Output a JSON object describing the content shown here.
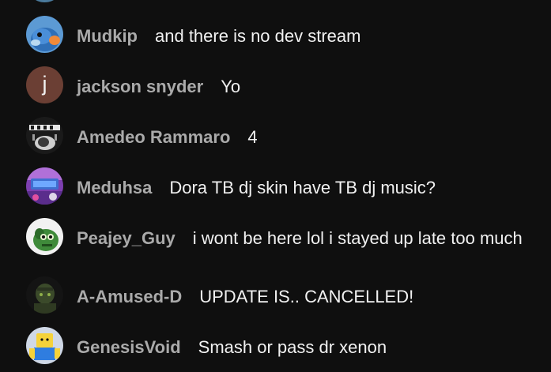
{
  "messages": [
    {
      "author": "Mudkip",
      "text": "and there is no dev stream",
      "avatar": "mudkip-avatar",
      "avatar_letter": ""
    },
    {
      "author": "jackson snyder",
      "text": "Yo",
      "avatar": "letter-avatar",
      "avatar_letter": "j"
    },
    {
      "author": "Amedeo Rammaro",
      "text": "4",
      "avatar": "amedeo-avatar",
      "avatar_letter": ""
    },
    {
      "author": "Meduhsa",
      "text": "Dora TB dj skin have TB dj music?",
      "avatar": "meduhsa-avatar",
      "avatar_letter": ""
    },
    {
      "author": "Peajey_Guy",
      "text": "i wont be here lol i stayed up late too much",
      "avatar": "peajey-avatar",
      "avatar_letter": ""
    },
    {
      "author": "A-Amused-D",
      "text": "UPDATE IS.. CANCELLED!",
      "avatar": "amused-avatar",
      "avatar_letter": ""
    },
    {
      "author": "GenesisVoid",
      "text": "Smash or pass dr xenon",
      "avatar": "genesis-avatar",
      "avatar_letter": ""
    }
  ],
  "colors": {
    "background": "#0f0f0f",
    "author": "#aaaaaa",
    "message": "#f1f1f1",
    "letter_avatar_bg": "#6b3f34"
  }
}
